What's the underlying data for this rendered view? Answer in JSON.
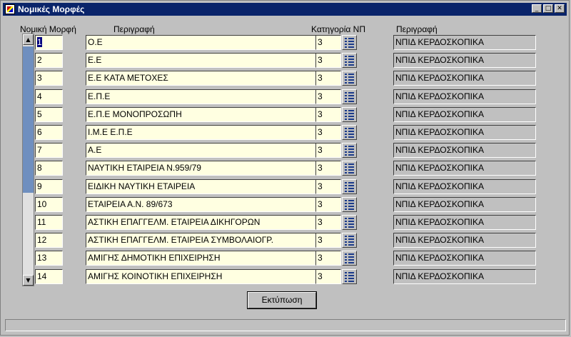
{
  "window": {
    "title": "Νομικές Μορφές"
  },
  "headers": {
    "code": "Νομική Μορφή",
    "description": "Περιγραφή",
    "category": "Κατηγορία ΝΠ",
    "category_desc": "Περιγραφή"
  },
  "rows": [
    {
      "code": "1",
      "description": "Ο.Ε",
      "category": "3",
      "category_desc": "ΝΠΙΔ ΚΕΡΔΟΣΚΟΠΙΚΑ"
    },
    {
      "code": "2",
      "description": "Ε.Ε",
      "category": "3",
      "category_desc": "ΝΠΙΔ ΚΕΡΔΟΣΚΟΠΙΚΑ"
    },
    {
      "code": "3",
      "description": "Ε.Ε ΚΑΤΑ ΜΕΤΟΧΕΣ",
      "category": "3",
      "category_desc": "ΝΠΙΔ ΚΕΡΔΟΣΚΟΠΙΚΑ"
    },
    {
      "code": "4",
      "description": "Ε.Π.Ε",
      "category": "3",
      "category_desc": "ΝΠΙΔ ΚΕΡΔΟΣΚΟΠΙΚΑ"
    },
    {
      "code": "5",
      "description": "Ε.Π.Ε ΜΟΝΟΠΡΟΣΩΠΗ",
      "category": "3",
      "category_desc": "ΝΠΙΔ ΚΕΡΔΟΣΚΟΠΙΚΑ"
    },
    {
      "code": "6",
      "description": "Ι.Μ.Ε Ε.Π.Ε",
      "category": "3",
      "category_desc": "ΝΠΙΔ ΚΕΡΔΟΣΚΟΠΙΚΑ"
    },
    {
      "code": "7",
      "description": "Α.Ε",
      "category": "3",
      "category_desc": "ΝΠΙΔ ΚΕΡΔΟΣΚΟΠΙΚΑ"
    },
    {
      "code": "8",
      "description": "ΝΑΥΤΙΚΗ ΕΤΑΙΡΕΙΑ Ν.959/79",
      "category": "3",
      "category_desc": "ΝΠΙΔ ΚΕΡΔΟΣΚΟΠΙΚΑ"
    },
    {
      "code": "9",
      "description": "ΕΙΔΙΚΗ ΝΑΥΤΙΚΗ ΕΤΑΙΡΕΙΑ",
      "category": "3",
      "category_desc": "ΝΠΙΔ ΚΕΡΔΟΣΚΟΠΙΚΑ"
    },
    {
      "code": "10",
      "description": "ΕΤΑΙΡΕΙΑ Α.Ν. 89/673",
      "category": "3",
      "category_desc": "ΝΠΙΔ ΚΕΡΔΟΣΚΟΠΙΚΑ"
    },
    {
      "code": "11",
      "description": "ΑΣΤΙΚΗ ΕΠΑΓΓΕΛΜ. ΕΤΑΙΡΕΙΑ ΔΙΚΗΓΟΡΩΝ",
      "category": "3",
      "category_desc": "ΝΠΙΔ ΚΕΡΔΟΣΚΟΠΙΚΑ"
    },
    {
      "code": "12",
      "description": "ΑΣΤΙΚΗ ΕΠΑΓΓΕΛΜ. ΕΤΑΙΡΕΙΑ ΣΥΜΒΟΛΑΙΟΓΡ.",
      "category": "3",
      "category_desc": "ΝΠΙΔ ΚΕΡΔΟΣΚΟΠΙΚΑ"
    },
    {
      "code": "13",
      "description": "ΑΜΙΓΗΣ ΔΗΜΟΤΙΚΗ ΕΠΙΧΕΙΡΗΣΗ",
      "category": "3",
      "category_desc": "ΝΠΙΔ ΚΕΡΔΟΣΚΟΠΙΚΑ"
    },
    {
      "code": "14",
      "description": "ΑΜΙΓΗΣ ΚΟΙΝΟΤΙΚΗ ΕΠΙΧΕΙΡΗΣΗ",
      "category": "3",
      "category_desc": "ΝΠΙΔ ΚΕΡΔΟΣΚΟΠΙΚΑ"
    }
  ],
  "buttons": {
    "print": "Εκτύπωση"
  },
  "colors": {
    "titlebar": "#0a246a",
    "field_bg": "#ffffe1",
    "scroll_thumb": "#6f8fbf"
  }
}
